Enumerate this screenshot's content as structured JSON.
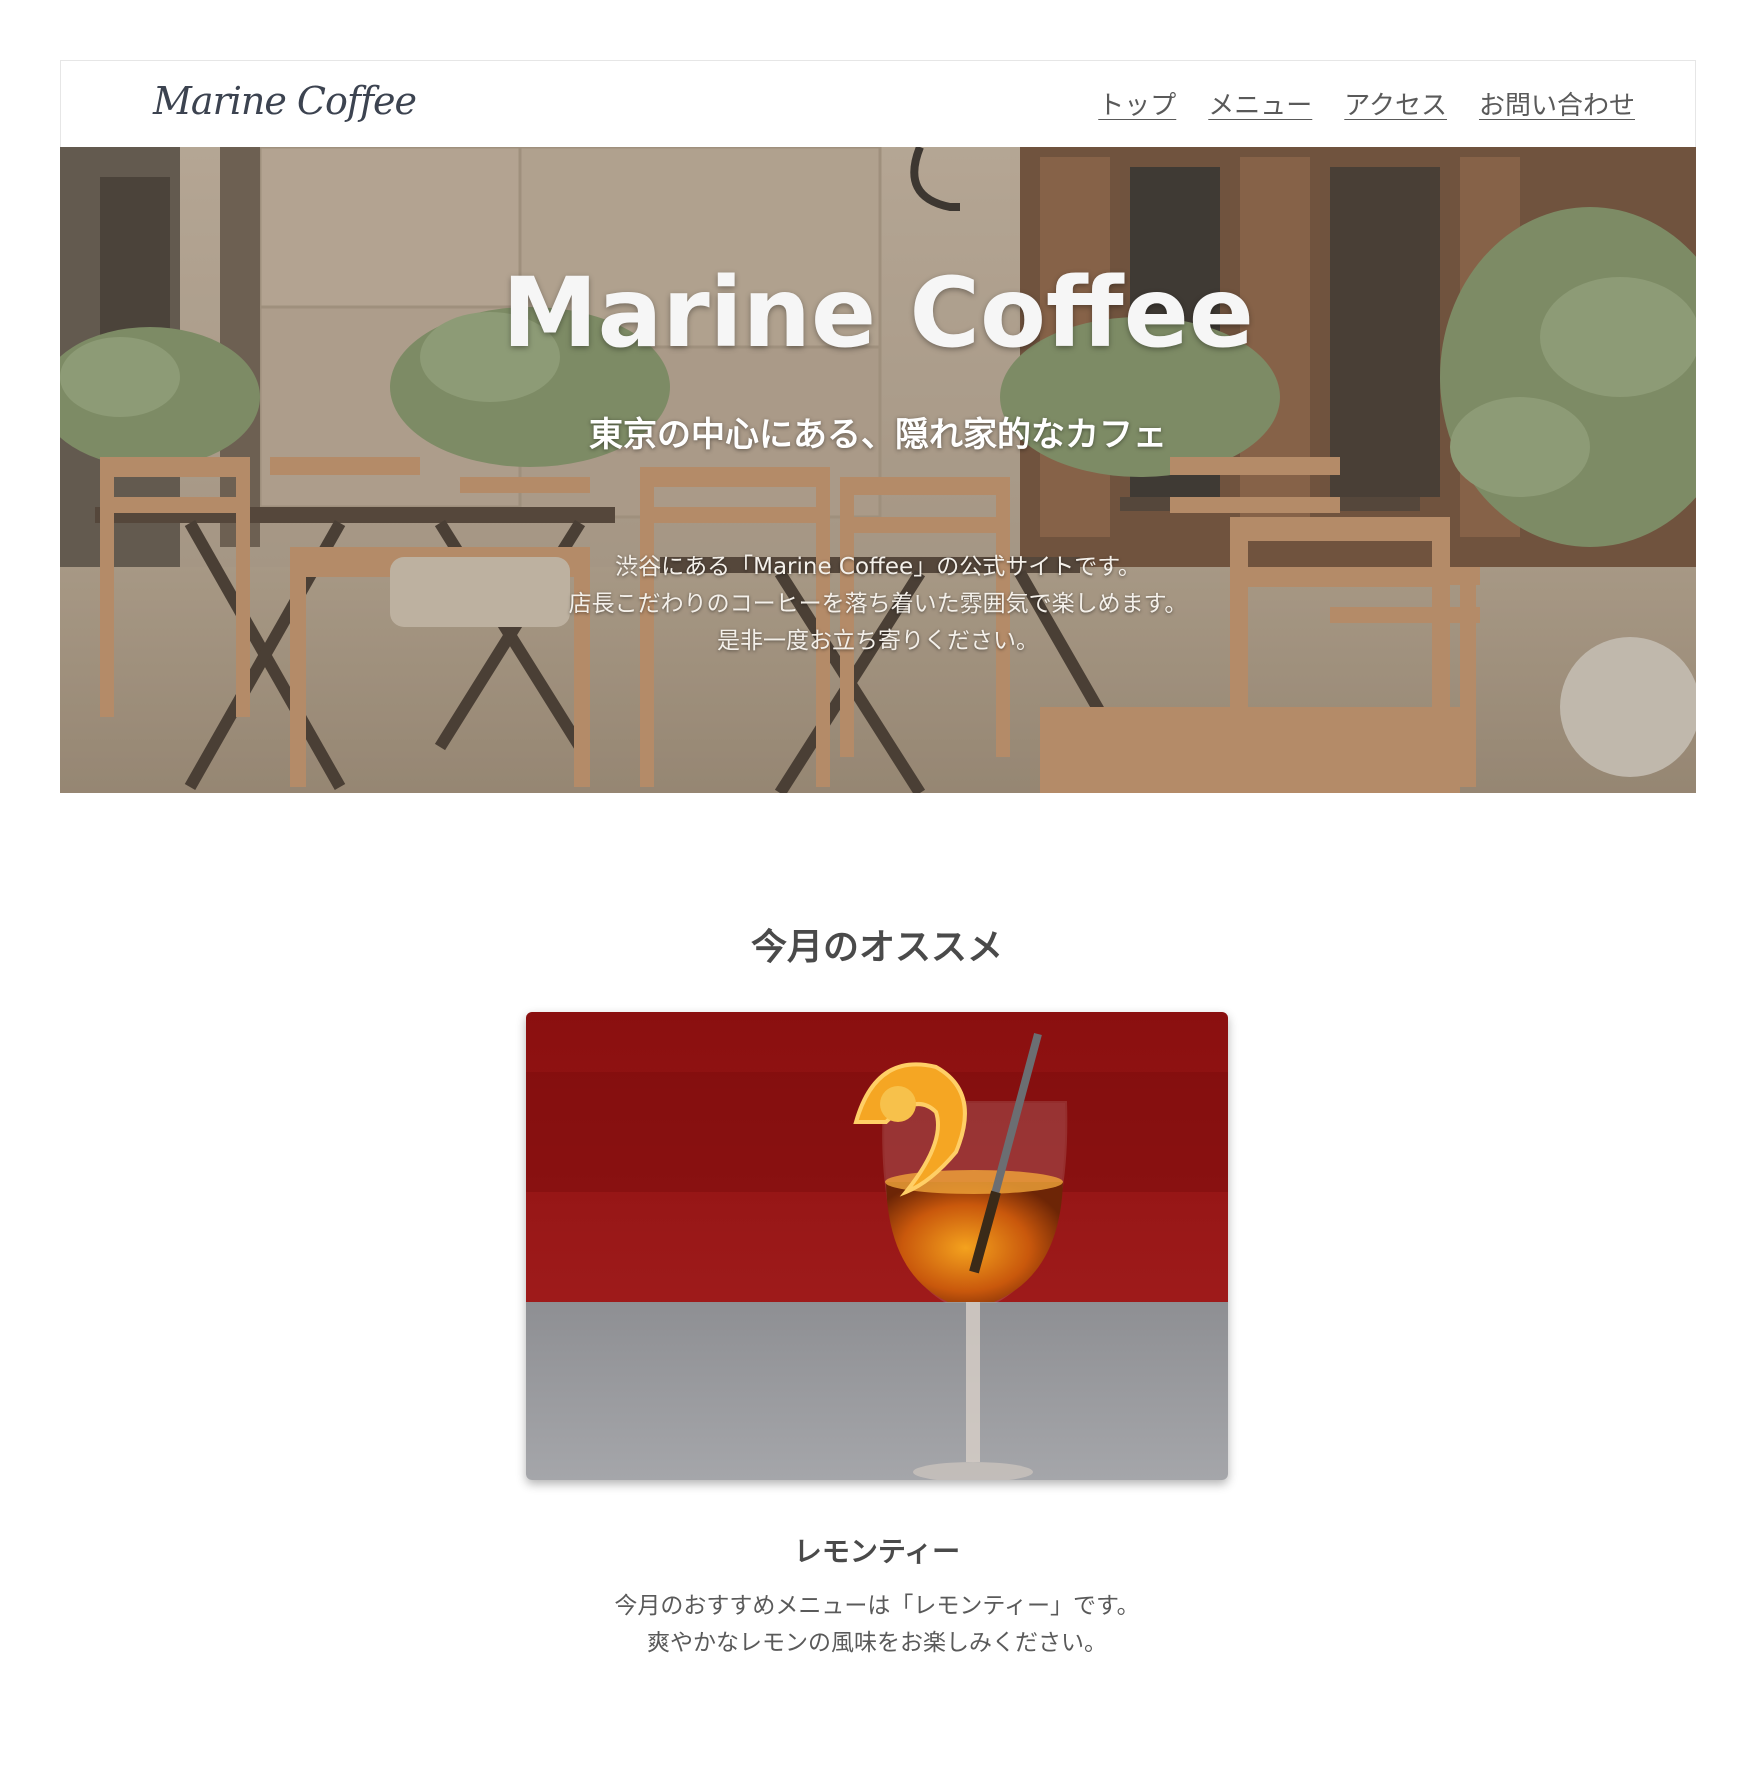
{
  "header": {
    "logo": "Marine Coffee",
    "nav": [
      "トップ",
      "メニュー",
      "アクセス",
      "お問い合わせ"
    ]
  },
  "hero": {
    "title": "Marine Coffee",
    "subtitle": "東京の中心にある、隠れ家的なカフェ",
    "description": [
      "渋谷にある「Marine Coffee」の公式サイトです。",
      "店長こだわりのコーヒーを落ち着いた雰囲気で楽しめます。",
      "是非一度お立ち寄りください。"
    ]
  },
  "recommend": {
    "title": "今月のオススメ",
    "item_name": "レモンティー",
    "description": [
      "今月のおすすめメニューは「レモンティー」です。",
      "爽やかなレモンの風味をお楽しみください。"
    ]
  },
  "colors": {
    "text": "#4a4a4a",
    "logo": "#3c4350",
    "background": "#ffffff"
  }
}
